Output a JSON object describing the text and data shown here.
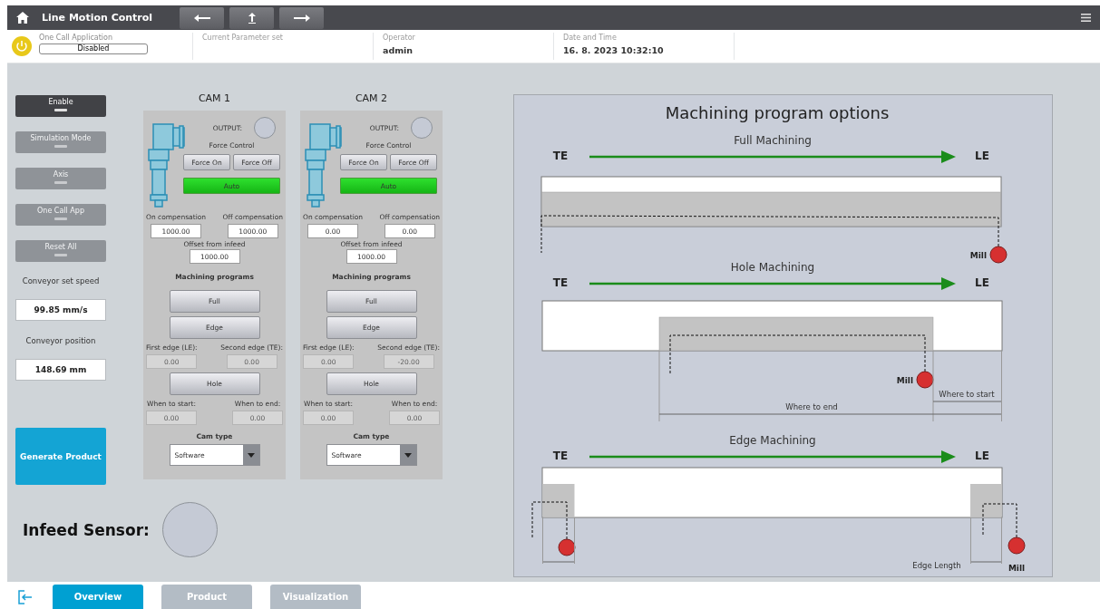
{
  "header": {
    "title": "Line Motion Control"
  },
  "info_fields": [
    {
      "label": "One Call Application",
      "value": "Disabled",
      "kind": "box"
    },
    {
      "label": "Current Parameter set",
      "kind": "text"
    },
    {
      "label": "Operator",
      "value": "admin",
      "kind": "text"
    },
    {
      "label": "Date and Time",
      "value": "16. 8. 2023 10:32:10",
      "kind": "text"
    }
  ],
  "controls": [
    {
      "label": "Enable",
      "disabled": false
    },
    {
      "label": "Simulation Mode",
      "disabled": true
    },
    {
      "label": "Axis",
      "disabled": true
    },
    {
      "label": "One Call App",
      "disabled": true
    },
    {
      "label": "Reset All",
      "disabled": true
    }
  ],
  "conveyor": [
    {
      "label": "Conveyor set speed",
      "value": "99.85 mm/s"
    },
    {
      "label": "Conveyor position",
      "value": "148.69 mm"
    }
  ],
  "generate_button": "Generate Product",
  "cams": [
    {
      "title": "CAM 1",
      "output_label": "OUTPUT:",
      "output_on": false,
      "force_label": "Force Control",
      "force_buttons": [
        "Force On",
        "Force Off"
      ],
      "auto": {
        "label": "Auto",
        "on": true
      },
      "compensation": [
        {
          "label": "On compensation",
          "value": "1000.00"
        },
        {
          "label": "Off compensation",
          "value": "1000.00"
        }
      ],
      "offset": {
        "label": "Offset from infeed",
        "value": "1000.00"
      },
      "programs_label": "Machining programs",
      "programs": [
        {
          "label": "Full"
        },
        {
          "label": "Edge",
          "params": [
            {
              "label": "First edge (LE):",
              "value": "0.00",
              "disabled": true
            },
            {
              "label": "Second edge (TE):",
              "value": "0.00",
              "disabled": true
            }
          ]
        },
        {
          "label": "Hole",
          "params": [
            {
              "label": "When to start:",
              "value": "0.00",
              "disabled": true
            },
            {
              "label": "When to end:",
              "value": "0.00",
              "disabled": true
            }
          ]
        }
      ],
      "cam_type": {
        "label": "Cam type",
        "value": "Software"
      }
    },
    {
      "title": "CAM 2",
      "output_label": "OUTPUT:",
      "output_on": false,
      "force_label": "Force Control",
      "force_buttons": [
        "Force On",
        "Force Off"
      ],
      "auto": {
        "label": "Auto",
        "on": true
      },
      "compensation": [
        {
          "label": "On compensation",
          "value": "0.00"
        },
        {
          "label": "Off compensation",
          "value": "0.00"
        }
      ],
      "offset": {
        "label": "Offset from infeed",
        "value": "1000.00"
      },
      "programs_label": "Machining programs",
      "programs": [
        {
          "label": "Full"
        },
        {
          "label": "Edge",
          "params": [
            {
              "label": "First edge (LE):",
              "value": "0.00",
              "disabled": true
            },
            {
              "label": "Second edge (TE):",
              "value": "-20.00",
              "disabled": true
            }
          ]
        },
        {
          "label": "Hole",
          "params": [
            {
              "label": "When to start:",
              "value": "0.00",
              "disabled": true
            },
            {
              "label": "When to end:",
              "value": "0.00",
              "disabled": true
            }
          ]
        }
      ],
      "cam_type": {
        "label": "Cam type",
        "value": "Software"
      }
    }
  ],
  "infeed_sensor": {
    "label": "Infeed Sensor:",
    "on": false
  },
  "diagram": {
    "title": "Machining program options",
    "sections": [
      {
        "kind": "full",
        "title": "Full Machining",
        "start": "TE",
        "end": "LE",
        "mill": "Mill"
      },
      {
        "kind": "hole",
        "title": "Hole Machining",
        "start": "TE",
        "end": "LE",
        "mill": "Mill",
        "dims": [
          "Where to start",
          "Where to end"
        ]
      },
      {
        "kind": "edge",
        "title": "Edge Machining",
        "start": "TE",
        "end": "LE",
        "mill": "Mill",
        "dims": [
          "Edge Length"
        ]
      }
    ]
  },
  "tabs": [
    {
      "label": "Overview",
      "selected": true
    },
    {
      "label": "Product",
      "selected": false
    },
    {
      "label": "Visualization",
      "selected": false
    }
  ]
}
